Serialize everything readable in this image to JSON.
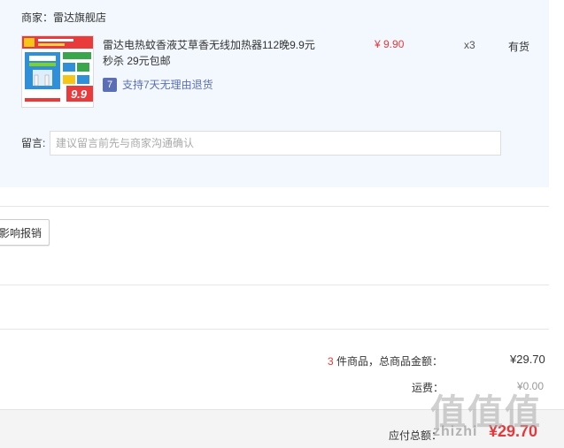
{
  "merchant": {
    "label": "商家：雷达旗舰店"
  },
  "product": {
    "title": "雷达电热蚊香液艾草香无线加热器112晚9.9元",
    "subtitle": "秒杀 29元包邮",
    "price": "¥ 9.90",
    "quantity": "x3",
    "stock": "有货",
    "return_badge": "7",
    "return_policy": "支持7天无理由退货",
    "thumb_price": "9.9"
  },
  "note": {
    "label": "留言:",
    "placeholder": "建议留言前先与商家沟通确认"
  },
  "invoice": {
    "button_label": "影响报销"
  },
  "summary": {
    "count": "3",
    "count_suffix": "件商品，总商品金额：",
    "amount": "¥29.70",
    "shipping_label": "运费：",
    "shipping_amount": "¥0.00",
    "total_label": "应付总额：",
    "total_amount": "¥29.70"
  },
  "watermark": {
    "logo_text": "值值值",
    "site": "zhizhi"
  },
  "colors": {
    "accent_red": "#e4393c",
    "badge_blue": "#5b6fb4",
    "merchant_bg": "#f2f8fd"
  }
}
